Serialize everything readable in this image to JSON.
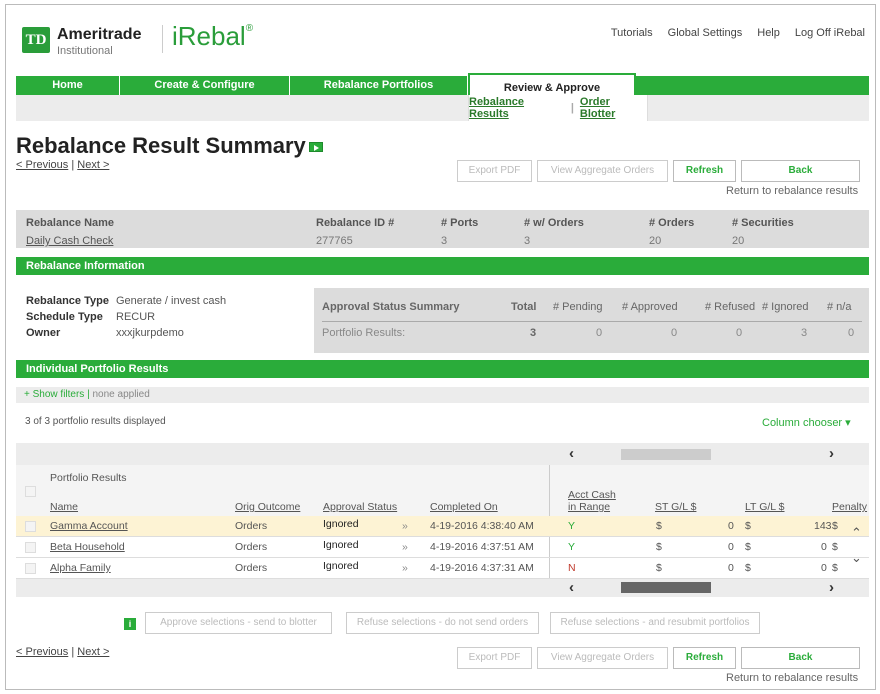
{
  "brand": {
    "name": "Ameritrade",
    "logo_text": "TD",
    "subtitle": "Institutional",
    "product": "iRebal",
    "product_mark": "®"
  },
  "top_links": [
    "Tutorials",
    "Global Settings",
    "Help",
    "Log Off iRebal"
  ],
  "nav": {
    "tabs": [
      "Home",
      "Create & Configure",
      "Rebalance Portfolios",
      "Review & Approve"
    ],
    "active": "Review & Approve"
  },
  "subnav": {
    "items": [
      "Rebalance Results",
      "Order Blotter"
    ],
    "sep": "|"
  },
  "page": {
    "title": "Rebalance Result Summary",
    "previous": "< Previous",
    "next": "Next >",
    "sep": "|"
  },
  "buttons": {
    "export_pdf": "Export PDF",
    "view_aggregate": "View Aggregate Orders",
    "refresh": "Refresh",
    "back": "Back",
    "return_text": "Return to rebalance results"
  },
  "summary": {
    "headers": [
      "Rebalance Name",
      "Rebalance ID #",
      "# Ports",
      "# w/ Orders",
      "# Orders",
      "# Securities"
    ],
    "values": [
      "Daily Cash Check",
      "277765",
      "3",
      "3",
      "20",
      "20"
    ]
  },
  "rebalance_info": {
    "heading": "Rebalance Information",
    "fields": [
      {
        "label": "Rebalance Type",
        "value": "Generate / invest cash"
      },
      {
        "label": "Schedule Type",
        "value": "RECUR"
      },
      {
        "label": "Owner",
        "value": "xxxjkurpdemo"
      }
    ]
  },
  "approval": {
    "headers": [
      "Approval Status Summary",
      "Total",
      "# Pending",
      "# Approved",
      "# Refused",
      "# Ignored",
      "# n/a"
    ],
    "row_label": "Portfolio Results:",
    "values": [
      "3",
      "0",
      "0",
      "0",
      "3",
      "0"
    ]
  },
  "results": {
    "heading": "Individual Portfolio Results",
    "show_filters": "+ Show filters",
    "filters_sep": "|",
    "filters_state": "none applied",
    "count_text": "3 of 3 portfolio results displayed",
    "column_chooser": "Column chooser ▾",
    "group_header": "Portfolio Results",
    "columns": [
      "Name",
      "Orig Outcome",
      "Approval Status",
      "Completed On",
      "Acct Cash",
      "in Range",
      "ST G/L $",
      "LT G/L $",
      "Penalty"
    ],
    "rows": [
      {
        "name": "Gamma Account",
        "outcome": "Orders",
        "status": "Ignored",
        "completed": "4-19-2016 4:38:40 AM",
        "in_range": "Y",
        "st_sym": "$",
        "st": "0",
        "lt_sym": "$",
        "lt": "143",
        "pen": "$"
      },
      {
        "name": "Beta Household",
        "outcome": "Orders",
        "status": "Ignored",
        "completed": "4-19-2016 4:37:51 AM",
        "in_range": "Y",
        "st_sym": "$",
        "st": "0",
        "lt_sym": "$",
        "lt": "0",
        "pen": "$"
      },
      {
        "name": "Alpha Family",
        "outcome": "Orders",
        "status": "Ignored",
        "completed": "4-19-2016 4:37:31 AM",
        "in_range": "N",
        "st_sym": "$",
        "st": "0",
        "lt_sym": "$",
        "lt": "0",
        "pen": "$"
      }
    ],
    "row_action": "»"
  },
  "footer_buttons": {
    "approve": "Approve selections - send to blotter",
    "refuse": "Refuse selections - do not send orders",
    "refuse_resubmit": "Refuse selections - and resubmit portfolios",
    "icon_text": "i"
  },
  "colors": {
    "green": "#2aac3a",
    "grey": "#dcdcdc",
    "highlight": "#fdf3d4"
  }
}
